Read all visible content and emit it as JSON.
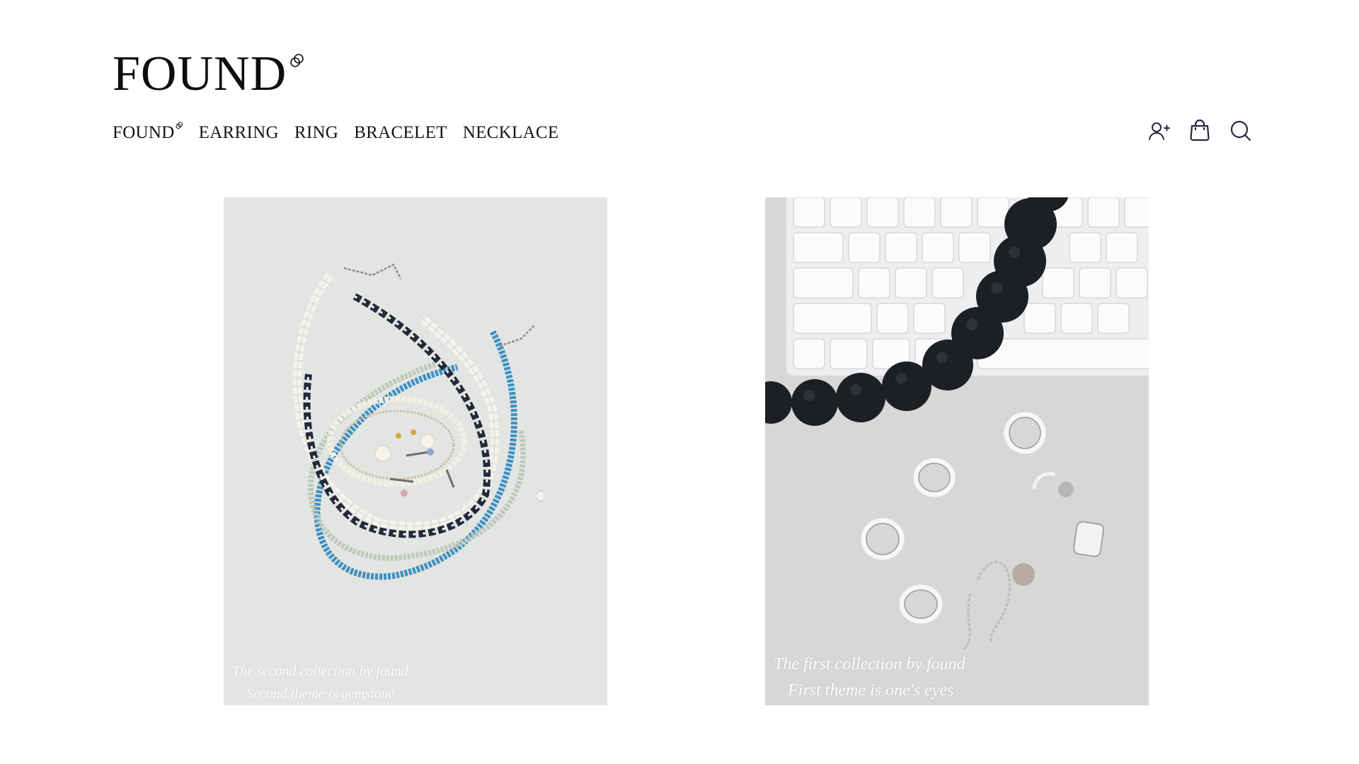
{
  "brand": {
    "name": "FOUND",
    "mark_icon": "linked-rings-icon"
  },
  "nav": {
    "items": [
      {
        "label": "FOUND",
        "has_mark": true
      },
      {
        "label": "EARRING"
      },
      {
        "label": "RING"
      },
      {
        "label": "BRACELET"
      },
      {
        "label": "NECKLACE"
      }
    ]
  },
  "tools": [
    {
      "name": "add-user-icon"
    },
    {
      "name": "shopping-bag-icon"
    },
    {
      "name": "search-icon"
    }
  ],
  "collections": [
    {
      "caption_line1": "The second collection by found",
      "caption_line2": "Second theme is gemstone",
      "image": "necklaces-and-earrings-photo"
    },
    {
      "caption_line1": "The first collection by found",
      "caption_line2": "First theme is one's eyes",
      "image": "rings-and-black-beads-on-keyboard-photo"
    }
  ],
  "colors": {
    "text": "#111111",
    "icon": "#2a2540",
    "background": "#ffffff"
  }
}
